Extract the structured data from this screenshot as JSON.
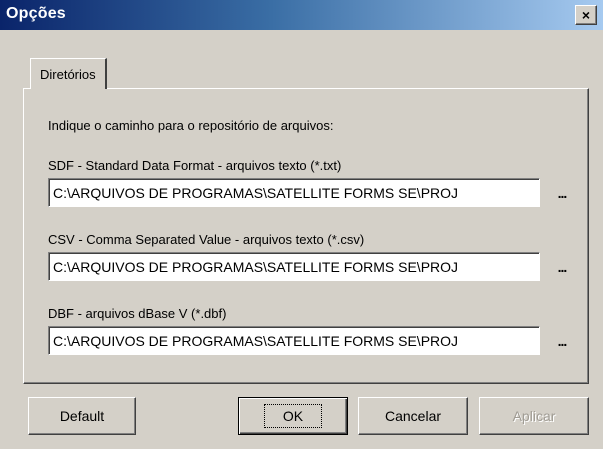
{
  "window": {
    "title": "Opções",
    "close_glyph": "×"
  },
  "tabs": [
    {
      "label": "Diretórios",
      "active": true
    }
  ],
  "panel": {
    "instruction": "Indique o caminho para o repositório de arquivos:",
    "fields": [
      {
        "label": "SDF - Standard Data Format - arquivos texto (*.txt)",
        "value": "C:\\ARQUIVOS DE PROGRAMAS\\SATELLITE FORMS SE\\PROJ",
        "browse_label": "..."
      },
      {
        "label": "CSV - Comma Separated Value - arquivos texto (*.csv)",
        "value": "C:\\ARQUIVOS DE PROGRAMAS\\SATELLITE FORMS SE\\PROJ",
        "browse_label": "..."
      },
      {
        "label": "DBF - arquivos dBase V (*.dbf)",
        "value": "C:\\ARQUIVOS DE PROGRAMAS\\SATELLITE FORMS SE\\PROJ",
        "browse_label": "..."
      }
    ]
  },
  "buttons": {
    "default": "Default",
    "ok": "OK",
    "cancel": "Cancelar",
    "apply": "Aplicar"
  },
  "icons": {
    "close": "close-icon"
  }
}
